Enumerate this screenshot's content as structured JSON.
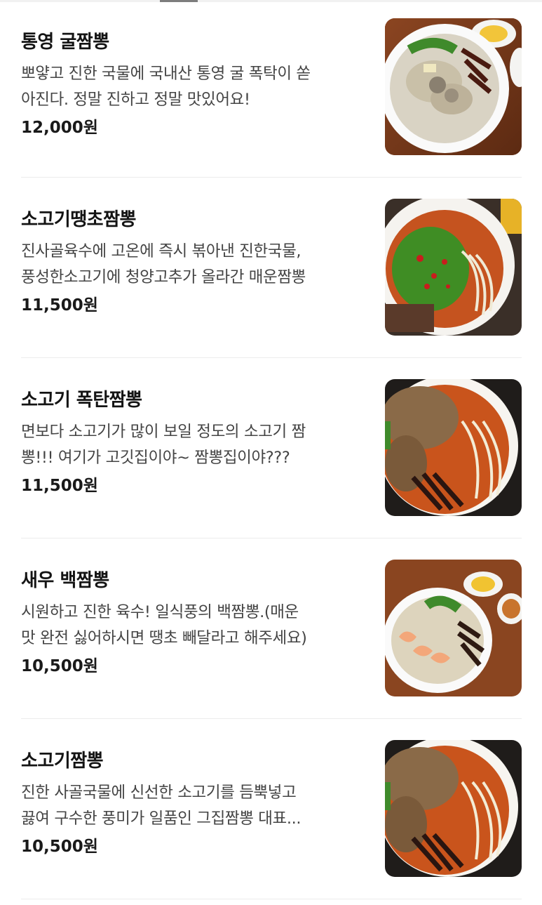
{
  "menu": {
    "items": [
      {
        "name": "통영 굴짬뽕",
        "description": "뽀얗고 진한 국물에 국내산 통영 굴 폭탁이 쏟\n아진다. 정말 진하고 정말 맛있어요!",
        "price": "12,000원",
        "image_icon": "oyster-jjamppong-photo"
      },
      {
        "name": "소고기땡초짬뽕",
        "description": "진사골육수에 고온에 즉시 볶아낸 진한국물,\n풍성한소고기에 청양고추가 올라간 매운짬뽕",
        "price": "11,500원",
        "image_icon": "beef-chili-jjamppong-photo"
      },
      {
        "name": "소고기 폭탄짬뽕",
        "description": "면보다 소고기가 많이 보일 정도의 소고기 짬\n뽕!!! 여기가 고깃집이야~ 짬뽕집이야???",
        "price": "11,500원",
        "image_icon": "beef-bomb-jjamppong-photo"
      },
      {
        "name": "새우 백짬뽕",
        "description": "시원하고 진한 육수! 일식풍의 백짬뽕.(매운\n맛 완전 싫어하시면 땡초 빼달라고 해주세요)",
        "price": "10,500원",
        "image_icon": "shrimp-white-jjamppong-photo"
      },
      {
        "name": "소고기짬뽕",
        "description": "진한 사골국물에 신선한 소고기를 듬뿍넣고\n끓여 구수한 풍미가 일품인 그집짬뽕 대표...",
        "price": "10,500원",
        "image_icon": "beef-jjamppong-photo"
      }
    ]
  }
}
